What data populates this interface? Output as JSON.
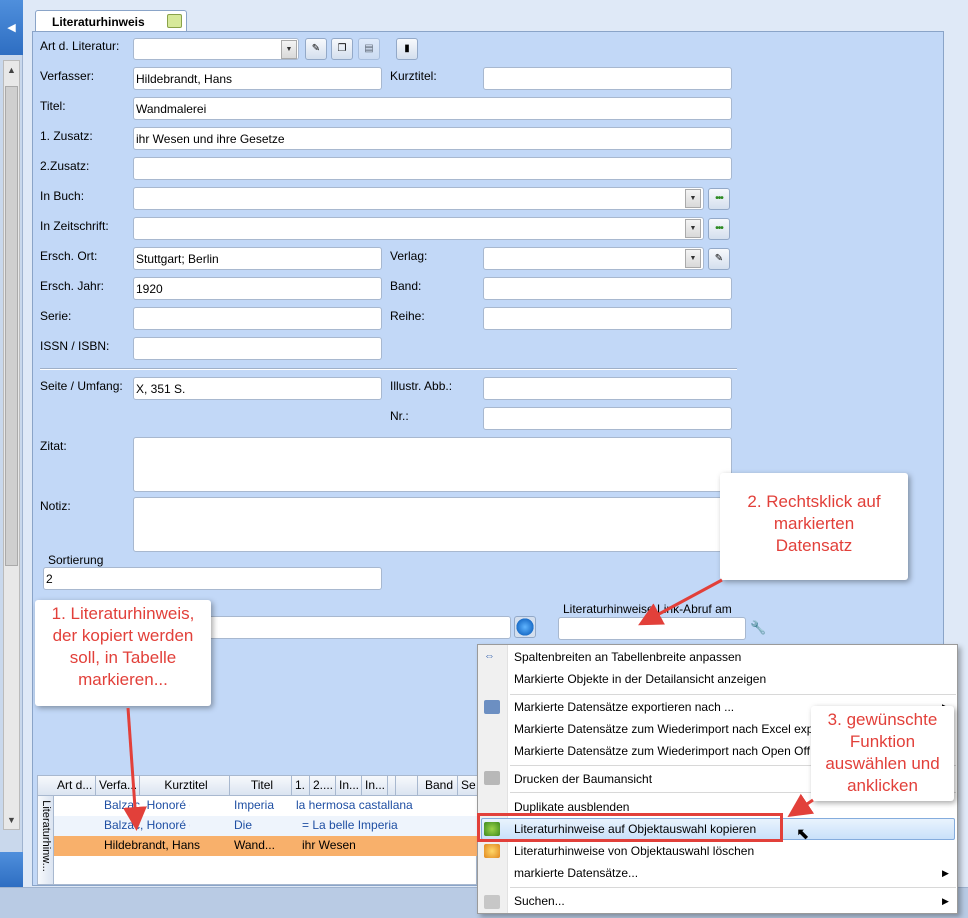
{
  "tab": {
    "title": "Literaturhinweis"
  },
  "form": {
    "art_label": "Art d. Literatur:",
    "verfasser_label": "Verfasser:",
    "verfasser_value": "Hildebrandt, Hans",
    "kurztitel_label": "Kurztitel:",
    "titel_label": "Titel:",
    "titel_value": "Wandmalerei",
    "zusatz1_label": "1. Zusatz:",
    "zusatz1_value": "ihr Wesen und ihre Gesetze",
    "zusatz2_label": "2.Zusatz:",
    "inbuch_label": "In Buch:",
    "inzeitschrift_label": "In Zeitschrift:",
    "erschort_label": "Ersch. Ort:",
    "erschort_value": "Stuttgart; Berlin",
    "verlag_label": "Verlag:",
    "erschjahr_label": "Ersch. Jahr:",
    "erschjahr_value": "1920",
    "band_label": "Band:",
    "serie_label": "Serie:",
    "reihe_label": "Reihe:",
    "issn_label": "ISSN / ISBN:",
    "seite_label": "Seite / Umfang:",
    "seite_value": "X, 351 S.",
    "illustr_label": "Illustr. Abb.:",
    "nr_label": "Nr.:",
    "zitat_label": "Zitat:",
    "notiz_label": "Notiz:",
    "sortierung_label": "Sortierung",
    "sortierung_value": "2",
    "linkabruf_label": "Literaturhinweise Link-Abruf am"
  },
  "callouts": {
    "c1": [
      "1. Literaturhinweis,",
      "der kopiert werden",
      "soll, in Tabelle",
      "markieren..."
    ],
    "c2": [
      "2. Rechtsklick auf",
      "markierten",
      "Datensatz"
    ],
    "c3": [
      "3. gewünschte",
      "Funktion",
      "auswählen und",
      "anklicken"
    ]
  },
  "grid": {
    "side_label": "Literaturhinw...",
    "headers": [
      "Art d...",
      "Verfa...",
      "Kurztitel",
      "Titel",
      "1.",
      "2....",
      "In...",
      "In...",
      "",
      "",
      "Band",
      "Se"
    ],
    "rows": [
      {
        "verfasser": "Balzac, Honoré de ;",
        "titel": "Imperia",
        "zusatz": "la hermosa castallana"
      },
      {
        "verfasser": "Balzac, Honoré de ;",
        "titel": "Die",
        "zusatz": "= La belle Imperia"
      },
      {
        "verfasser": "Hildebrandt, Hans",
        "titel": "Wand...",
        "zusatz": "ihr Wesen"
      }
    ]
  },
  "menu": {
    "items": [
      "Spaltenbreiten an Tabellenbreite anpassen",
      "Markierte Objekte in der Detailansicht anzeigen",
      "Markierte Datensätze exportieren nach ...",
      "Markierte Datensätze zum Wiederimport nach Excel exp",
      "Markierte Datensätze zum Wiederimport nach Open Off",
      "Drucken der Baumansicht",
      "Duplikate ausblenden",
      "Literaturhinweise auf Objektauswahl kopieren",
      "Literaturhinweise von Objektauswahl löschen",
      "markierte Datensätze...",
      "Suchen..."
    ]
  },
  "colors": {
    "accent_red": "#e2403a",
    "selected_row": "#f8b06b",
    "panel": "#c2d8f7"
  }
}
